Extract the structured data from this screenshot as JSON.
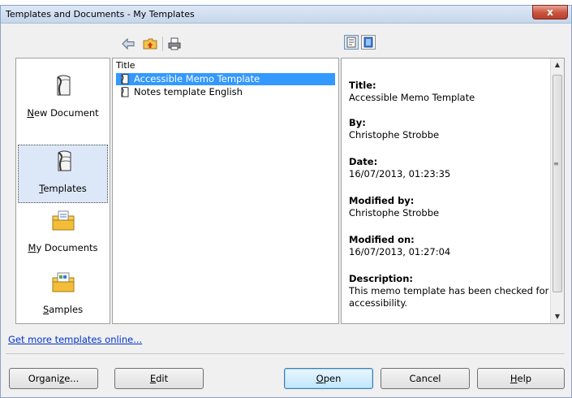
{
  "window": {
    "title": "Templates and Documents - My Templates",
    "close_glyph": "x"
  },
  "toolbar": {
    "icons": [
      "back-icon",
      "folder-up-icon",
      "print-icon"
    ],
    "view_icons": [
      "document-preview-icon",
      "document-properties-icon"
    ]
  },
  "sidebar": {
    "items": [
      {
        "label": "New Document",
        "mnemonic": "N",
        "rest": "ew Document",
        "icon": "new-document-icon"
      },
      {
        "label": "Templates",
        "mnemonic": "T",
        "rest": "emplates",
        "icon": "templates-icon",
        "selected": true
      },
      {
        "label": "My Documents",
        "mnemonic": "M",
        "rest": "y Documents",
        "icon": "my-documents-folder-icon"
      },
      {
        "label": "Samples",
        "mnemonic": "S",
        "rest": "amples",
        "icon": "samples-folder-icon"
      }
    ]
  },
  "filelist": {
    "column_header": "Title",
    "rows": [
      {
        "label": "Accessible Memo Template",
        "selected": true
      },
      {
        "label": "Notes template English",
        "selected": false
      }
    ]
  },
  "preview": {
    "fields": [
      {
        "key": "Title:",
        "value": "Accessible Memo Template"
      },
      {
        "key": "By:",
        "value": "Christophe Strobbe"
      },
      {
        "key": "Date:",
        "value": "16/07/2013, 01:23:35"
      },
      {
        "key": "Modified by:",
        "value": "Christophe Strobbe"
      },
      {
        "key": "Modified on:",
        "value": "16/07/2013, 01:27:04"
      },
      {
        "key": "Description:",
        "value_line1": "This memo template has been checked for",
        "value_line2": "accessibility."
      }
    ]
  },
  "links": {
    "get_more": "Get more templates online..."
  },
  "buttons": {
    "organize": {
      "label": "Organize...",
      "pre": "Organi",
      "mn": "z",
      "post": "e..."
    },
    "edit": {
      "label": "Edit",
      "pre": "",
      "mn": "E",
      "post": "dit"
    },
    "open": {
      "label": "Open",
      "pre": "",
      "mn": "O",
      "post": "pen"
    },
    "cancel": {
      "label": "Cancel"
    },
    "help": {
      "label": "Help",
      "pre": "",
      "mn": "H",
      "post": "elp"
    }
  }
}
